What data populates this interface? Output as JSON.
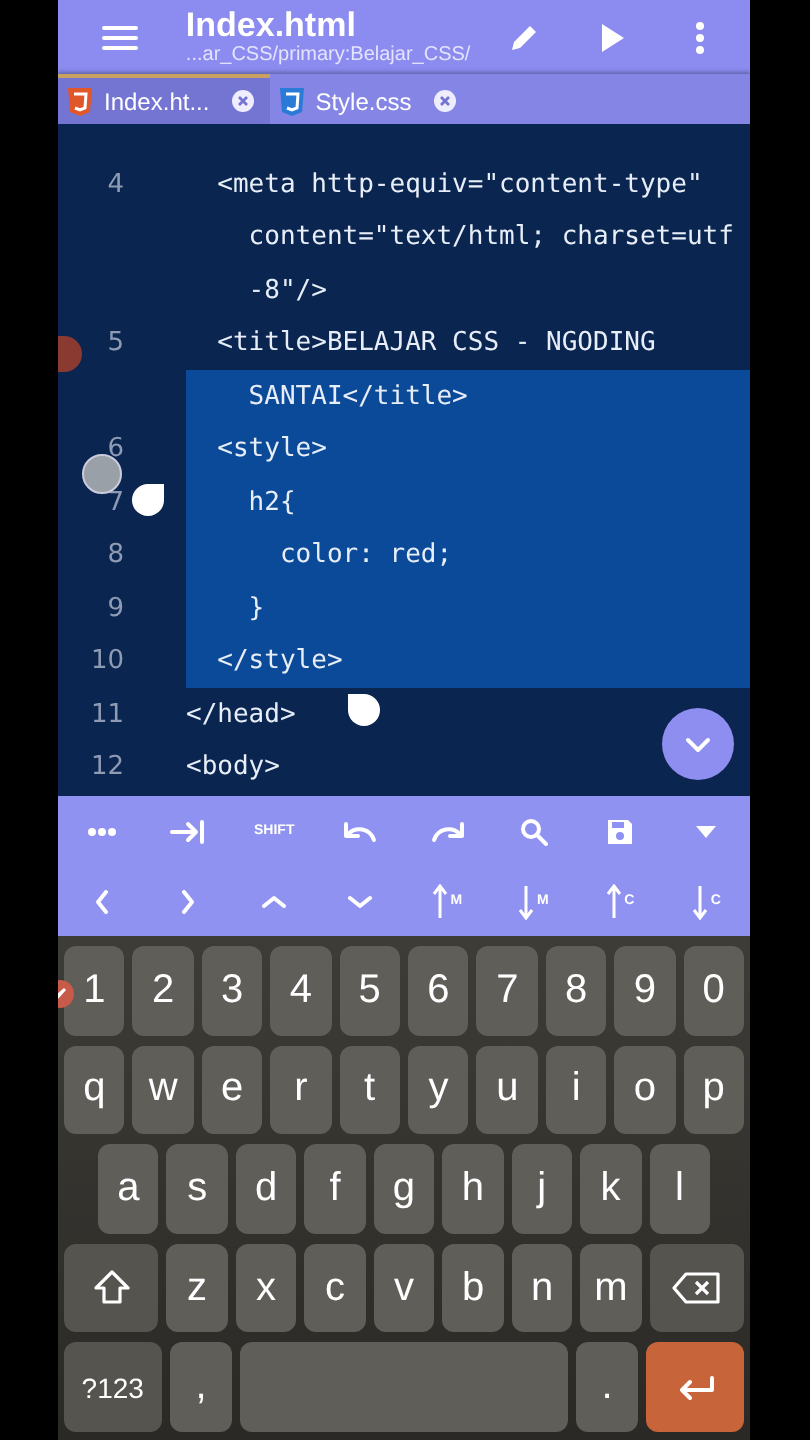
{
  "app_bar": {
    "title": "Index.html",
    "path": "...ar_CSS/primary:Belajar_CSS/"
  },
  "tabs": [
    {
      "label": "Index.ht...",
      "kind": "html",
      "selected": true
    },
    {
      "label": "Style.css",
      "kind": "css",
      "selected": false
    }
  ],
  "editor": {
    "rows": [
      {
        "number": "4",
        "text": "  <meta http-equiv=\"content-type\"",
        "selected": false
      },
      {
        "text": "    content=\"text/html; charset=utf",
        "selected": false
      },
      {
        "text": "    -8\"/>",
        "selected": false
      },
      {
        "number": "5",
        "text": "  <title>BELAJAR CSS - NGODING",
        "selected": false
      },
      {
        "text": "    SANTAI</title>",
        "selected": true
      },
      {
        "number": "6",
        "text": "  <style>",
        "selected": true
      },
      {
        "number": "7",
        "text": "    h2{",
        "selected": true
      },
      {
        "number": "8",
        "text": "      color: red;",
        "selected": true
      },
      {
        "number": "9",
        "text": "    }",
        "selected": true
      },
      {
        "number": "10",
        "text": "  </style>",
        "selected": true
      },
      {
        "number": "11",
        "text": "</head>",
        "selected": false
      },
      {
        "number": "12",
        "text": "<body>",
        "selected": false
      }
    ]
  },
  "toolbar": {
    "rows": [
      [
        {
          "kind": "icon"
        },
        {
          "kind": "icon"
        },
        {
          "kind": "text",
          "label": "SHIFT"
        },
        {
          "kind": "icon"
        },
        {
          "kind": "icon"
        },
        {
          "kind": "icon"
        },
        {
          "kind": "icon"
        },
        {
          "kind": "icon"
        }
      ],
      [
        {
          "kind": "icon"
        },
        {
          "kind": "icon"
        },
        {
          "kind": "icon"
        },
        {
          "kind": "icon"
        },
        {
          "kind": "jump",
          "label": "M"
        },
        {
          "kind": "jump",
          "label": "M"
        },
        {
          "kind": "jump",
          "label": "C"
        },
        {
          "kind": "jump",
          "label": "C"
        }
      ]
    ]
  },
  "keyboard": {
    "rows": [
      [
        {
          "kind": "key",
          "label": "1"
        },
        {
          "kind": "key",
          "label": "2"
        },
        {
          "kind": "key",
          "label": "3"
        },
        {
          "kind": "key",
          "label": "4"
        },
        {
          "kind": "key",
          "label": "5"
        },
        {
          "kind": "key",
          "label": "6"
        },
        {
          "kind": "key",
          "label": "7"
        },
        {
          "kind": "key",
          "label": "8"
        },
        {
          "kind": "key",
          "label": "9"
        },
        {
          "kind": "key",
          "label": "0"
        }
      ],
      [
        {
          "kind": "key",
          "label": "q"
        },
        {
          "kind": "key",
          "label": "w"
        },
        {
          "kind": "key",
          "label": "e"
        },
        {
          "kind": "key",
          "label": "r"
        },
        {
          "kind": "key",
          "label": "t"
        },
        {
          "kind": "key",
          "label": "y"
        },
        {
          "kind": "key",
          "label": "u"
        },
        {
          "kind": "key",
          "label": "i"
        },
        {
          "kind": "key",
          "label": "o"
        },
        {
          "kind": "key",
          "label": "p"
        }
      ],
      [
        {
          "kind": "key",
          "label": "a"
        },
        {
          "kind": "key",
          "label": "s"
        },
        {
          "kind": "key",
          "label": "d"
        },
        {
          "kind": "key",
          "label": "f"
        },
        {
          "kind": "key",
          "label": "g"
        },
        {
          "kind": "key",
          "label": "h"
        },
        {
          "kind": "key",
          "label": "j"
        },
        {
          "kind": "key",
          "label": "k"
        },
        {
          "kind": "key",
          "label": "l"
        }
      ],
      [
        {
          "kind": "shift"
        },
        {
          "kind": "key",
          "label": "z"
        },
        {
          "kind": "key",
          "label": "x"
        },
        {
          "kind": "key",
          "label": "c"
        },
        {
          "kind": "key",
          "label": "v"
        },
        {
          "kind": "key",
          "label": "b"
        },
        {
          "kind": "key",
          "label": "n"
        },
        {
          "kind": "key",
          "label": "m"
        },
        {
          "kind": "backspace"
        }
      ],
      [
        {
          "kind": "mode",
          "label": "?123"
        },
        {
          "kind": "key",
          "label": ","
        },
        {
          "kind": "space"
        },
        {
          "kind": "key",
          "label": "."
        },
        {
          "kind": "enter"
        }
      ]
    ]
  }
}
